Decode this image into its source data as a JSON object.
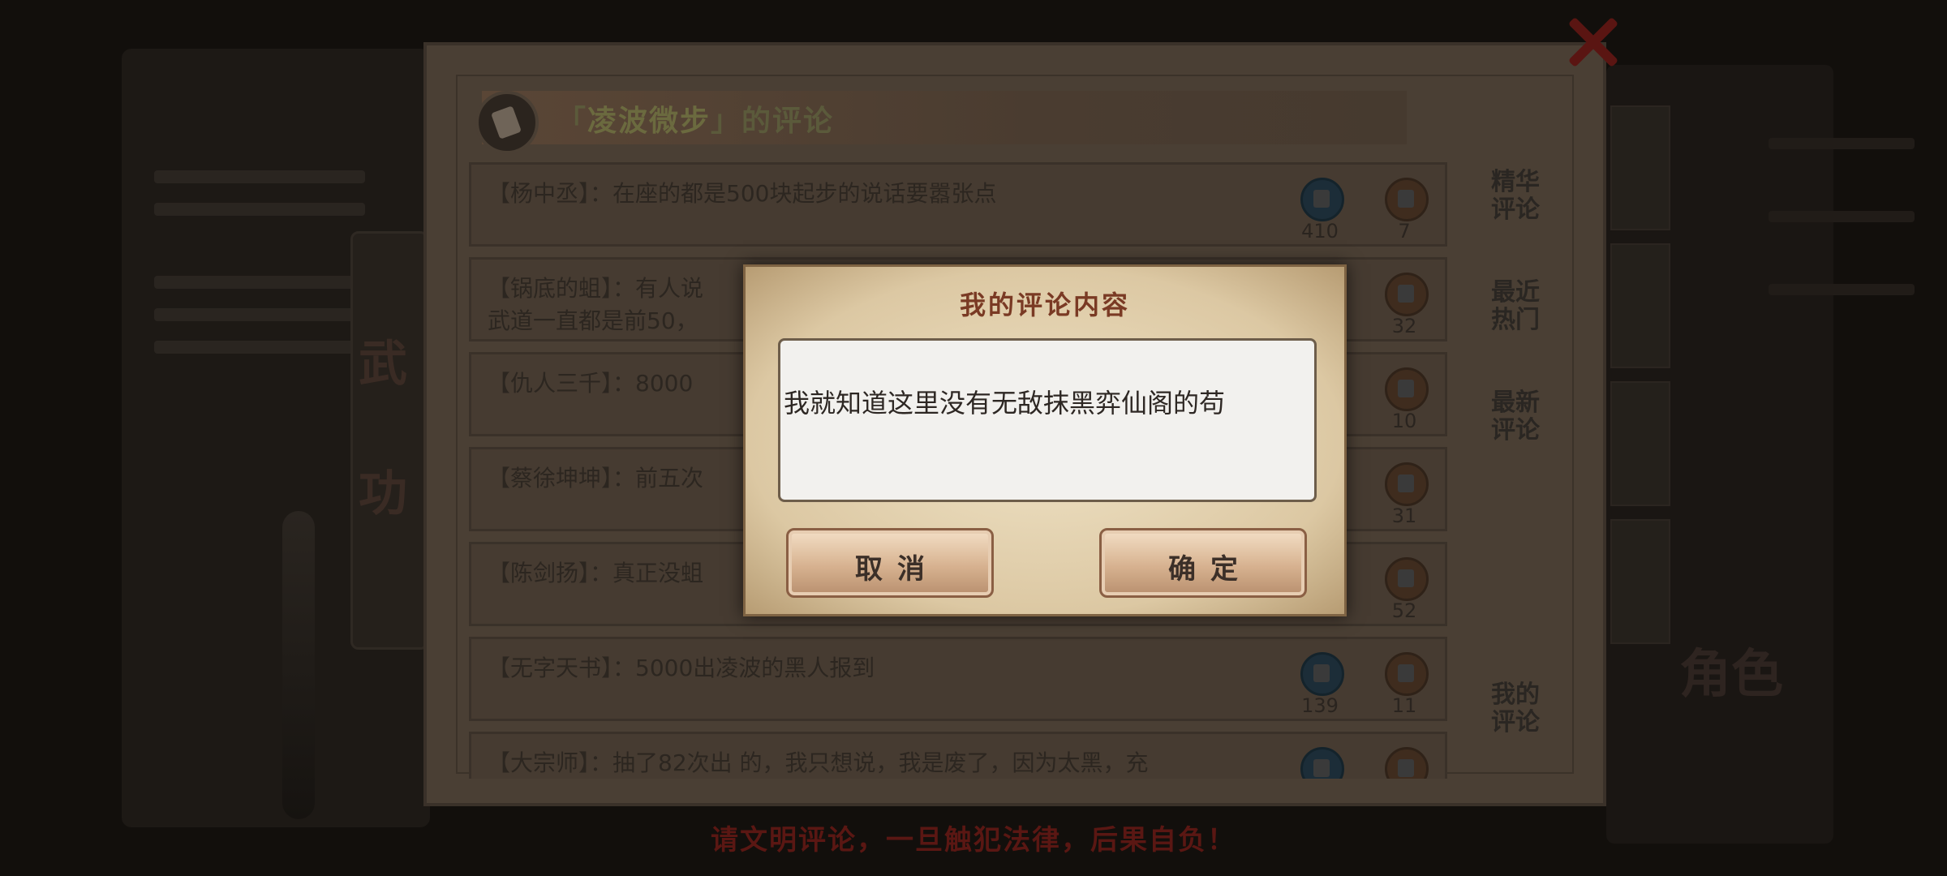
{
  "board": {
    "title_open": "「",
    "title_name": "凌波微步",
    "title_close": "」",
    "title_suffix": "的评论",
    "comments": [
      {
        "user": "【杨中丞】",
        "text": "：在座的都是500块起步的说话要嚣张点",
        "line2": "",
        "likes": "410",
        "dislikes": "7"
      },
      {
        "user": "【锅底的蛆】",
        "text": "：有人说",
        "line2": "武道一直都是前50，",
        "likes": "",
        "dislikes": "32"
      },
      {
        "user": "【仇人三千】",
        "text": "：8000",
        "line2": "",
        "likes": "",
        "dislikes": "10"
      },
      {
        "user": "【蔡徐坤坤】",
        "text": "：前五次",
        "line2": "",
        "likes": "",
        "dislikes": "31"
      },
      {
        "user": "【陈剑扬】",
        "text": "：真正没蛆",
        "line2": "",
        "likes": "",
        "dislikes": "52"
      },
      {
        "user": "【无字天书】",
        "text": "：5000出凌波的黑人报到",
        "line2": "",
        "likes": "139",
        "dislikes": "11"
      },
      {
        "user": "【大宗师】",
        "text": "：抽了82次出 的，我只想说，我是废了，因为太黑，充",
        "line2": "",
        "likes": "",
        "dislikes": ""
      }
    ],
    "tabs": [
      {
        "l1": "精华",
        "l2": "评论"
      },
      {
        "l1": "最近",
        "l2": "热门"
      },
      {
        "l1": "最新",
        "l2": "评论"
      },
      {
        "l1": "我的",
        "l2": "评论"
      }
    ],
    "footer_warning": "请文明评论，一旦触犯法律，后果自负！"
  },
  "background": {
    "side_chars": [
      "武",
      "功"
    ],
    "right_char": "角色"
  },
  "dialog": {
    "title": "我的评论内容",
    "comment_text": "我就知道这里没有无敌抹黑弈仙阁的苟",
    "cancel_label": "取消",
    "confirm_label": "确定"
  },
  "colors": {
    "dialog_title": "#7a3a24",
    "footer_warning": "#5a1713",
    "close_icon": "#5a1512"
  }
}
